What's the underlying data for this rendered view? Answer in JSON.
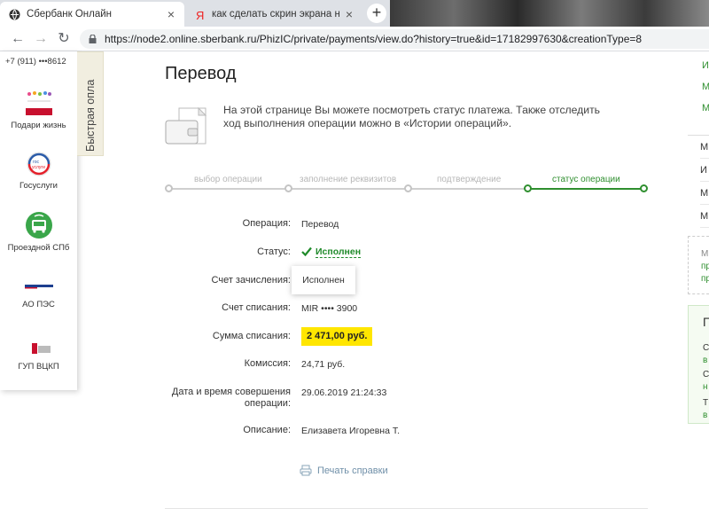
{
  "browser": {
    "tabs": [
      {
        "title": "Сбербанк Онлайн",
        "icon": "sberbank-globe-icon",
        "close": "×"
      },
      {
        "title": "как сделать скрин экрана на ко",
        "icon": "yandex-icon",
        "close": "×"
      }
    ],
    "new_tab": "+",
    "url": "https://node2.online.sberbank.ru/PhizIC/private/payments/view.do?history=true&id=17182997630&creationType=8"
  },
  "sidebar": {
    "phone": "+7 (911) •••8612",
    "quick_pay_tab": "Быстрая опла",
    "services": [
      {
        "label": "Подари жизнь",
        "icon": "podari-zhizn-logo"
      },
      {
        "label": "Госуслуги",
        "icon": "gosuslugi-logo"
      },
      {
        "label": "Проездной СПб",
        "icon": "bus-ticket-logo"
      },
      {
        "label": "АО ПЭС",
        "icon": "pes-logo"
      },
      {
        "label": "ГУП ВЦКП",
        "icon": "vckp-logo"
      }
    ]
  },
  "main": {
    "title": "Перевод",
    "info": "На этой странице Вы можете посмотреть статус платежа. Также отследить ход выполнения операции можно в «Истории операций».",
    "steps": [
      {
        "label": "выбор операции",
        "active": false
      },
      {
        "label": "заполнение реквизитов",
        "active": false
      },
      {
        "label": "подтверждение",
        "active": false
      },
      {
        "label": "статус операции",
        "active": true
      }
    ],
    "details": {
      "operation_label": "Операция:",
      "operation_value": "Перевод",
      "status_label": "Статус:",
      "status_value": "Исполнен",
      "credit_account_label": "Счет зачисления:",
      "tooltip": "Исполнен",
      "debit_account_label": "Счет списания:",
      "debit_account_value": "MIR  •••• 3900",
      "amount_label": "Сумма списания:",
      "amount_value": "2 471,00 руб.",
      "fee_label": "Комиссия:",
      "fee_value": "24,71 руб.",
      "datetime_label": "Дата и время совершения операции:",
      "datetime_value": "29.06.2019 21:24:33",
      "description_label": "Описание:",
      "description_value": "Елизавета Игоревна Т."
    },
    "print_link": "Печать справки"
  },
  "right_panel": {
    "links": [
      "И",
      "М",
      "М"
    ],
    "menu": [
      "М",
      "И",
      "М",
      "М"
    ],
    "box": [
      "М",
      "пр",
      "пр"
    ],
    "green": [
      "П",
      "С",
      "в",
      "С",
      "н",
      "Т",
      "в"
    ]
  },
  "colors": {
    "accent_green": "#2f8f2f",
    "highlight_yellow": "#ffe600",
    "link_blue": "#6f8fa8"
  }
}
